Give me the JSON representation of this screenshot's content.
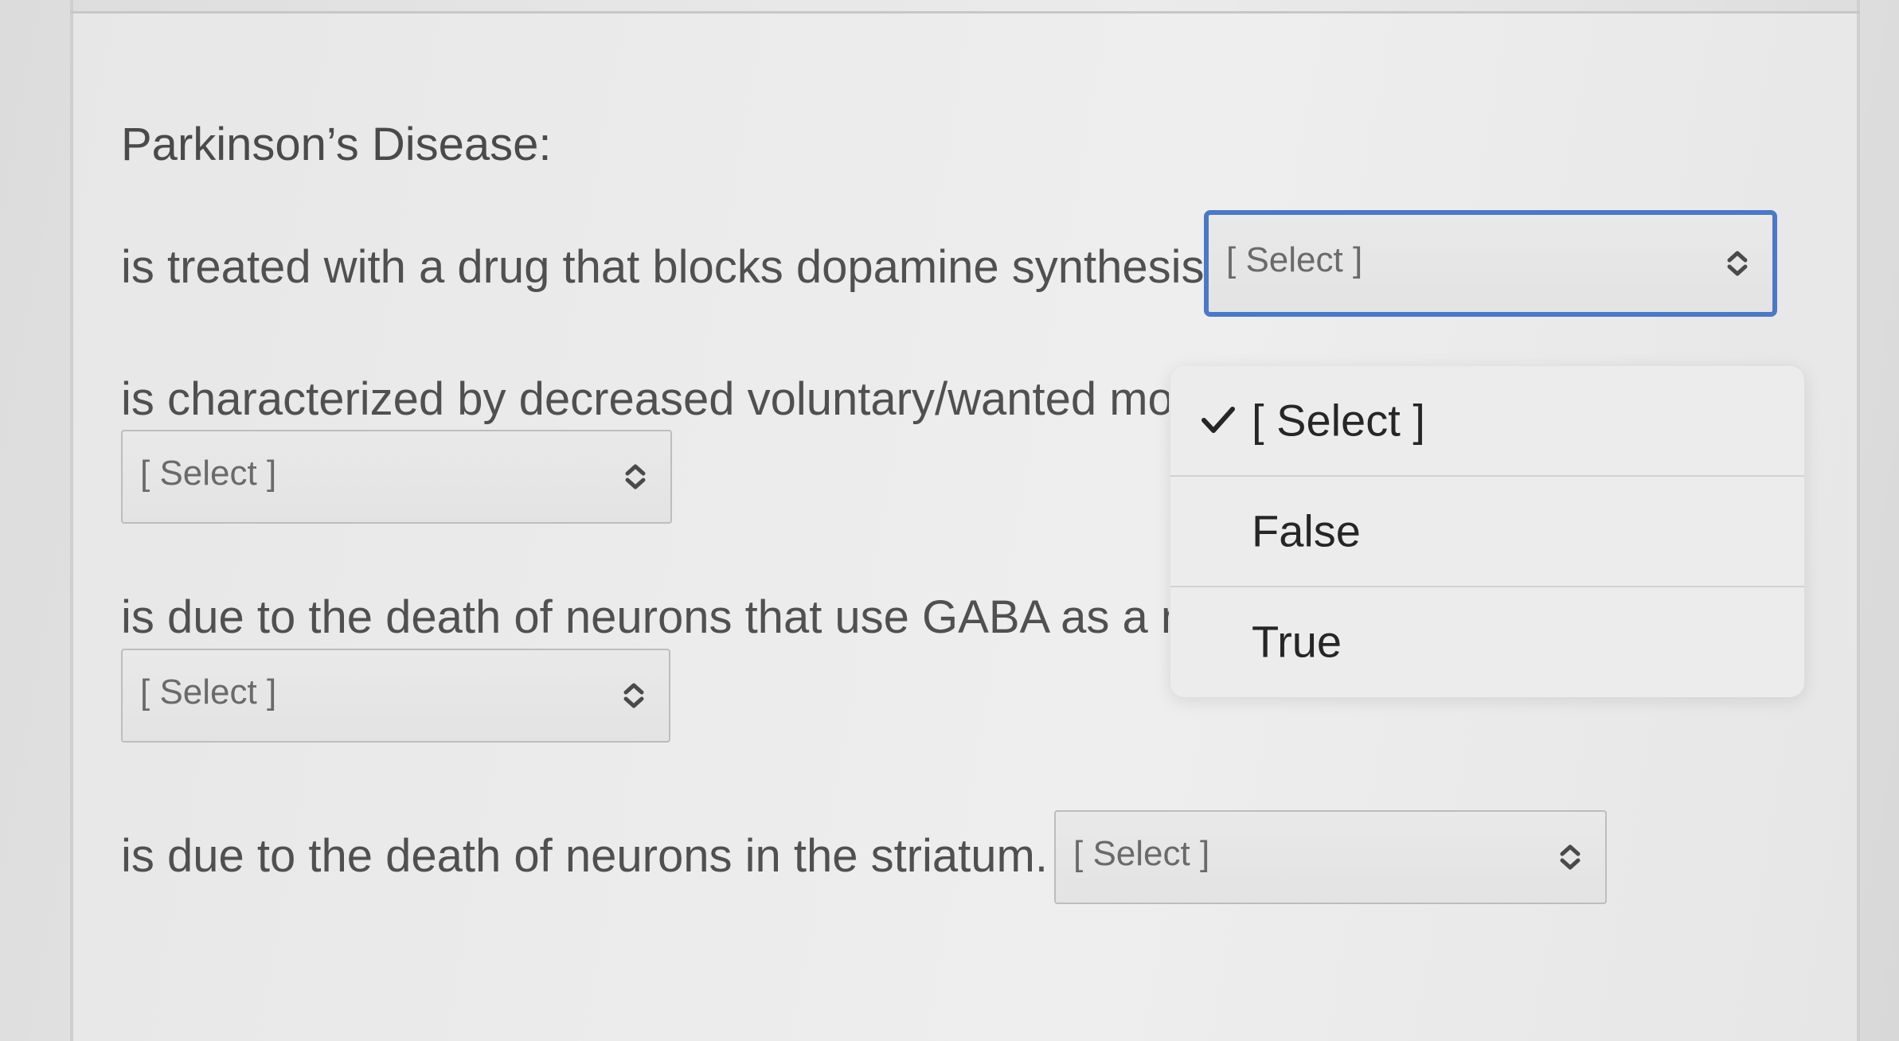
{
  "quiz": {
    "heading": "Parkinson’s Disease:",
    "questions": [
      {
        "prompt": "is treated with a drug that blocks dopamine synthesis.",
        "selected": "[ Select ]"
      },
      {
        "prompt": "is characterized by decreased voluntary/wanted mov",
        "selected": "[ Select ]"
      },
      {
        "prompt": "is due to the death of neurons that use GABA as a n",
        "selected": "[ Select ]"
      },
      {
        "prompt": "is due to the death of neurons in the striatum.",
        "selected": "[ Select ]"
      }
    ]
  },
  "dropdown": {
    "options": [
      "[ Select ]",
      "False",
      "True"
    ],
    "checked_index": 0
  },
  "colors": {
    "focus_ring": "#4a79c9",
    "text": "#505050"
  },
  "icons": {
    "select_chevron": "chevron-up-down-icon",
    "checkmark": "check-icon"
  }
}
